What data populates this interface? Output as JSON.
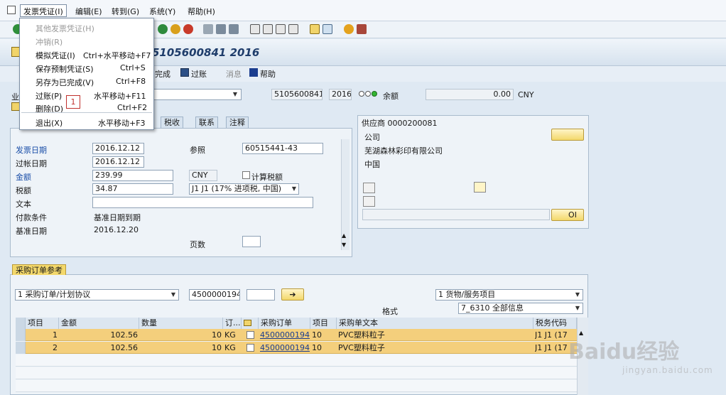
{
  "menubar": {
    "items": [
      "发票凭证(I)",
      "编辑(E)",
      "转到(G)",
      "系统(Y)",
      "帮助(H)"
    ]
  },
  "dropdown": {
    "items": [
      {
        "label": "其他发票凭证(H)",
        "shortcut": "",
        "disabled": true
      },
      {
        "label": "冲销(R)",
        "shortcut": "",
        "disabled": true
      },
      {
        "label": "模拟凭证(I)",
        "shortcut": "Ctrl+水平移动+F7",
        "disabled": false
      },
      {
        "label": "保存预制凭证(S)",
        "shortcut": "Ctrl+S",
        "disabled": false
      },
      {
        "label": "另存为已完成(V)",
        "shortcut": "Ctrl+F8",
        "disabled": false
      },
      {
        "label": "过账(P)",
        "shortcut": "水平移动+F11",
        "disabled": false
      },
      {
        "label": "删除(D)",
        "shortcut": "Ctrl+F2",
        "disabled": false
      },
      {
        "label": "退出(X)",
        "shortcut": "水平移动+F3",
        "disabled": false
      }
    ],
    "annotation": "1"
  },
  "title": "5105600841 2016",
  "apptoolbar": {
    "complete": "完成",
    "post": "过账",
    "message": "消息",
    "help": "帮助"
  },
  "header": {
    "label_prefix": "业",
    "doc_number": "5105600841",
    "year": "2016",
    "balance_label": "余额",
    "balance_value": "0.00",
    "currency": "CNY"
  },
  "tabs": {
    "tax": "税收",
    "contact": "联系",
    "note": "注释"
  },
  "basic": {
    "invoice_date_label": "发票日期",
    "invoice_date": "2016.12.12",
    "posting_date_label": "过帐日期",
    "posting_date": "2016.12.12",
    "amount_label": "金额",
    "amount": "239.99",
    "currency": "CNY",
    "calc_tax_label": "计算税额",
    "tax_label": "税额",
    "tax": "34.87",
    "tax_code": "J1 J1 (17% 进项税, 中国)",
    "reference_label": "参照",
    "reference": "60515441-43",
    "text_label": "文本",
    "text": "",
    "payment_terms_label": "付款条件",
    "payment_terms": "基准日期到期",
    "baseline_date_label": "基准日期",
    "baseline_date": "2016.12.20",
    "pages_label": "页数",
    "pages": ""
  },
  "vendor": {
    "title": "供应商 0000200081",
    "company_label": "公司",
    "name": "芜湖森林彩印有限公司",
    "country": "中国",
    "oi_label": "OI"
  },
  "po_section": {
    "tab": "采购订单参考",
    "ref_type": "1 采购订单/计划协议",
    "po_number": "4500000194",
    "item_type": "1 货物/服务项目",
    "layout_label": "格式",
    "layout": "7_6310 全部信息"
  },
  "grid": {
    "headers": [
      "项目",
      "金额",
      "数量",
      "订...",
      "",
      "采购订单",
      "项目",
      "采购单文本",
      "税务代码"
    ],
    "rows": [
      {
        "item": "1",
        "amount": "102.56",
        "qty": "10",
        "unit": "KG",
        "po": "4500000194",
        "po_item": "10",
        "text": "PVC塑料粒子",
        "tax": "J1  J1  (17"
      },
      {
        "item": "2",
        "amount": "102.56",
        "qty": "10",
        "unit": "KG",
        "po": "4500000194",
        "po_item": "10",
        "text": "PVC塑料粒子",
        "tax": "J1  J1  (17"
      }
    ]
  },
  "watermark": {
    "brand": "Baidu经验",
    "url": "jingyan.baidu.com"
  },
  "colors": {
    "row_highlight": "#f4cf7c",
    "title_text": "#1f3d6b",
    "label_blue": "#1b4fa8",
    "annotation_red": "#c0302c"
  }
}
